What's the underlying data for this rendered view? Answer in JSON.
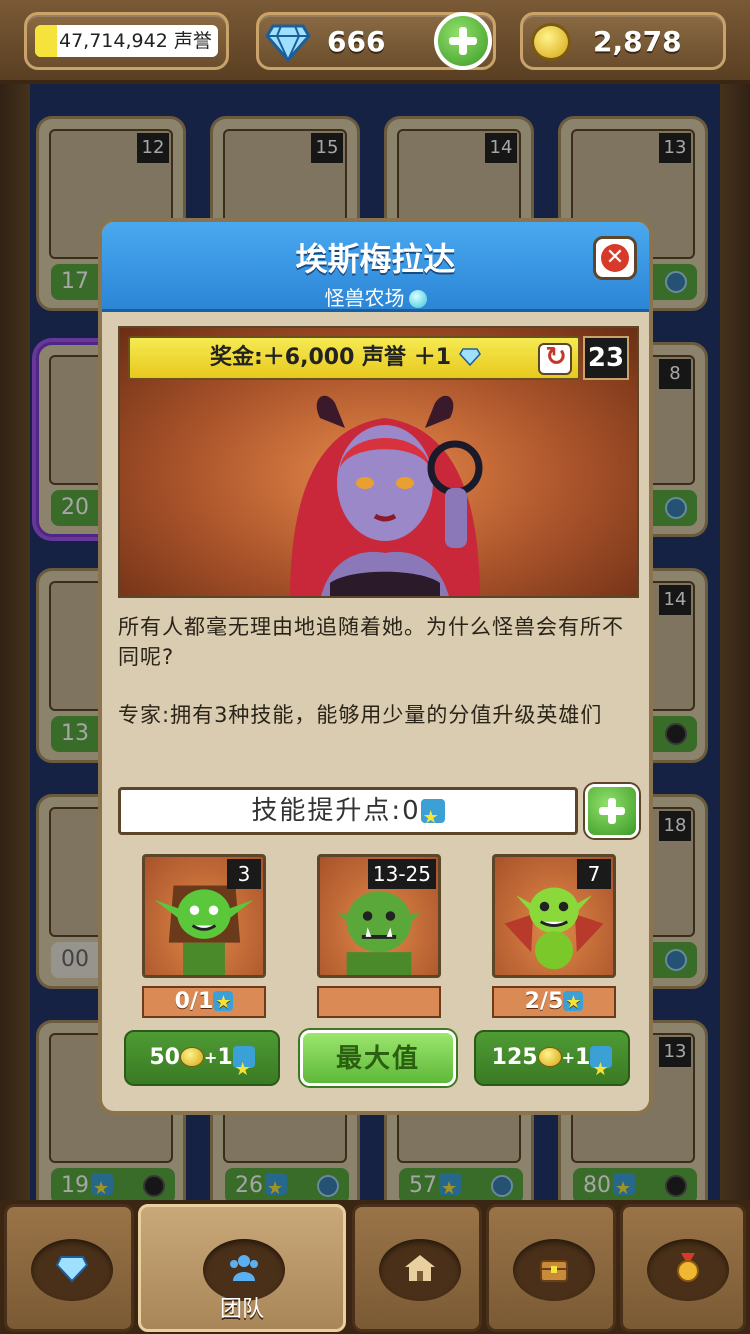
{
  "topbar": {
    "reputation": "47,714,942 声誉",
    "reputation_progress": 0.12,
    "gems": "666",
    "coins": "2,878"
  },
  "background_cards": [
    {
      "level": "12",
      "footer": "17"
    },
    {
      "level": "15",
      "footer": ""
    },
    {
      "level": "14",
      "footer": ""
    },
    {
      "level": "13",
      "footer": ""
    },
    {
      "level": "",
      "footer": "20"
    },
    {
      "level": "8",
      "footer": ""
    },
    {
      "level": "",
      "footer": "13"
    },
    {
      "level": "14",
      "footer": ""
    },
    {
      "level": "",
      "footer": "00"
    },
    {
      "level": "18",
      "footer": ""
    },
    {
      "level": "",
      "footer": "19"
    },
    {
      "level": "",
      "footer": "26"
    },
    {
      "level": "",
      "footer": "57"
    },
    {
      "level": "13",
      "footer": "80"
    }
  ],
  "modal": {
    "title": "埃斯梅拉达",
    "subtitle": "怪兽农场",
    "bonus": "奖金:＋6,000 声誉 ＋1",
    "hero_level": "23",
    "description_1": "所有人都毫无理由地追随着她。为什么怪兽会有所不同呢?",
    "description_2": "专家:拥有3种技能，能够用少量的分值升级英雄们",
    "skill_points": "技能提升点:0",
    "skills": [
      {
        "tag": "3",
        "progress": "0/1",
        "cost": "50",
        "cost_stars": "1",
        "icon": "goblin-rogue-icon"
      },
      {
        "tag": "13-25",
        "progress": "",
        "cost": "最大值",
        "cost_stars": "",
        "icon": "orc-icon"
      },
      {
        "tag": "7",
        "progress": "2/5",
        "cost": "125",
        "cost_stars": "1",
        "icon": "winged-goblin-icon"
      }
    ]
  },
  "nav": {
    "tabs": [
      {
        "icon": "gem-icon",
        "label": ""
      },
      {
        "icon": "team-icon",
        "label": "团队"
      },
      {
        "icon": "house-icon",
        "label": ""
      },
      {
        "icon": "chest-icon",
        "label": ""
      },
      {
        "icon": "medal-icon",
        "label": ""
      }
    ]
  }
}
